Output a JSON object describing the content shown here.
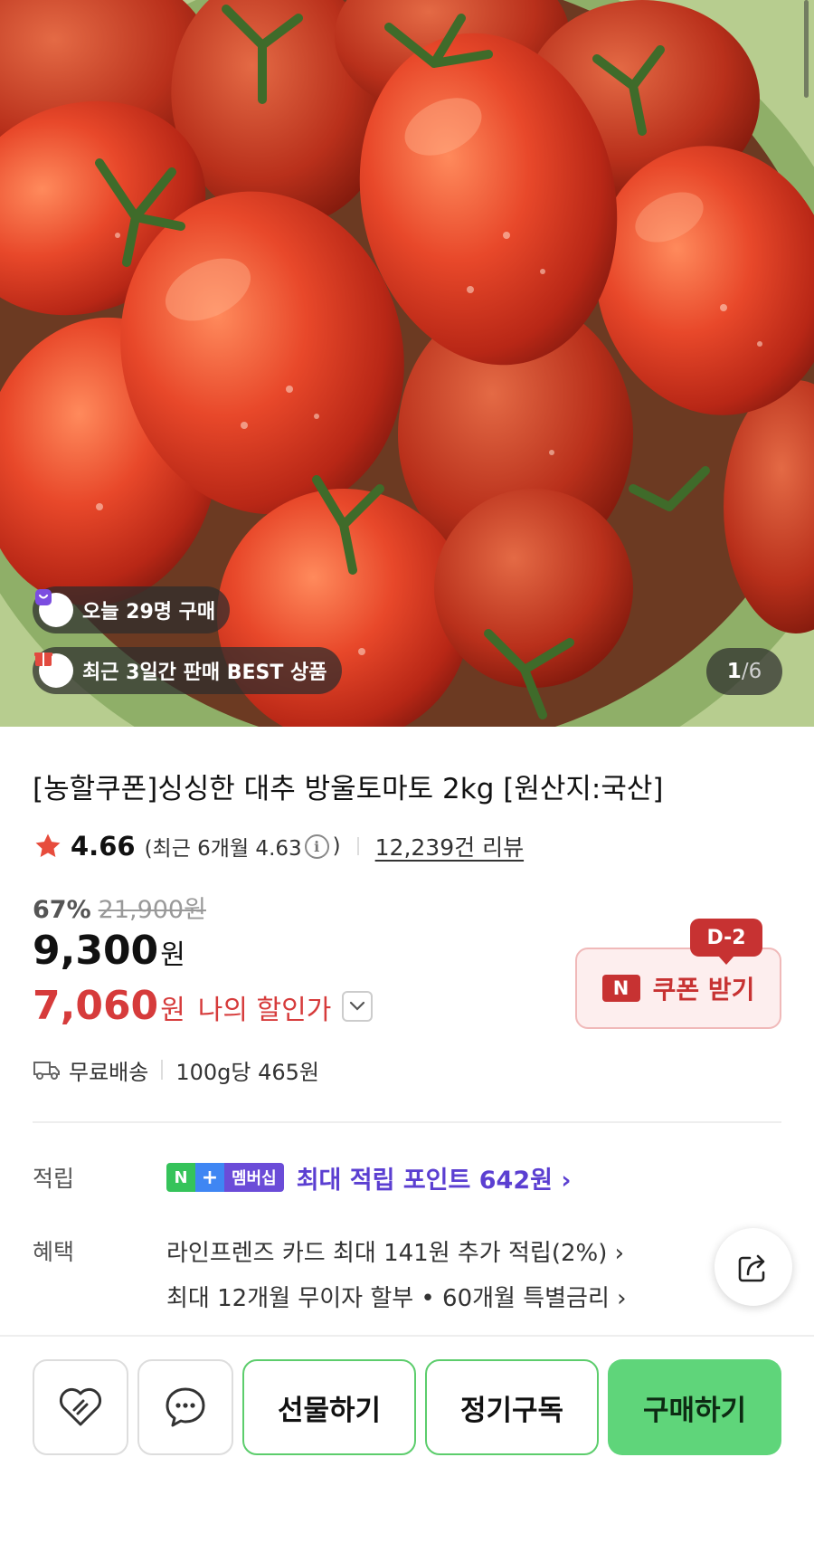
{
  "hero": {
    "badges": [
      {
        "icon": "shopping-bag-icon",
        "text": "오늘 29명 구매"
      },
      {
        "icon": "gift-box-icon",
        "text": "최근 3일간 판매 BEST 상품"
      }
    ],
    "page_current": "1",
    "page_separator": "/",
    "page_total": "6"
  },
  "product": {
    "title": "[농할쿠폰]싱싱한 대추 방울토마토 2kg [원산지:국산]",
    "rating": "4.66",
    "recent_rating_text": "(최근 6개월 4.63",
    "recent_close": ")",
    "info_glyph": "i",
    "review_count": "12,239건 리뷰",
    "discount_percent": "67%",
    "original_price": "21,900원",
    "price": "9,300",
    "price_unit": "원",
    "my_price": "7,060",
    "my_price_unit": "원",
    "my_price_label": "나의 할인가",
    "coupon_badge": "D-2",
    "coupon_n": "N",
    "coupon_label": "쿠폰 받기",
    "shipping": "무료배송",
    "unit_price": "100g당 465원"
  },
  "points": {
    "label": "적립",
    "badge_n": "N",
    "badge_plus": "+",
    "badge_membership": "멤버십",
    "text": "최대 적립 포인트 642원 ›"
  },
  "benefits": {
    "label": "혜택",
    "lines": [
      "라인프렌즈 카드 최대 141원 추가 적립(2%) ›",
      "최대 12개월 무이자 할부 • 60개월 특별금리 ›"
    ]
  },
  "actions": {
    "gift": "선물하기",
    "subscribe": "정기구독",
    "buy": "구매하기"
  },
  "colors": {
    "accent_green": "#5fd57a",
    "sale_red": "#d63b3b",
    "membership_purple": "#5b3fd1"
  }
}
